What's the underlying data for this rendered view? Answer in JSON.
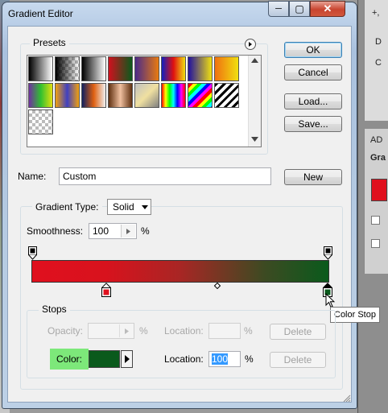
{
  "window": {
    "title": "Gradient Editor",
    "min_glyph": "─",
    "max_glyph": "▢",
    "close_glyph": "✕"
  },
  "background_app": {
    "right_texts": [
      "+,",
      "D",
      "C",
      "AD",
      "Gra"
    ]
  },
  "presets": {
    "legend": "Presets",
    "menu_icon": "circle-arrow-icon",
    "swatches": [
      "linear-gradient(90deg,#000,#fff)",
      "checker-fade-black",
      "linear-gradient(90deg,#000,#fff)",
      "linear-gradient(90deg,#d0101e,#0b5a1c)",
      "linear-gradient(90deg,#4a2a8a,#e87a10)",
      "linear-gradient(90deg,#1020c0,#e01010,#f0e010)",
      "linear-gradient(90deg,#2010a0,#f0e010)",
      "linear-gradient(90deg,#f07010,#f0e010)",
      "linear-gradient(90deg,#7030a0,#30c030,#e0e010)",
      "linear-gradient(90deg,#f0a010,#4040c0,#f0a010)",
      "linear-gradient(90deg,#102060,#e06010,#f0f0f0)",
      "linear-gradient(90deg,#603010,#f0c0a0,#603010)",
      "linear-gradient(135deg,#c0c0c0,#f0e0a0,#808080)",
      "linear-gradient(90deg,#f00,#ff0,#0f0,#0ff,#00f,#f0f,#f00)",
      "repeating-linear-gradient(135deg,#f00 0 4px,#ff0 4px 8px,#0f0 8px 12px,#0ff 12px 16px,#00f 16px 20px,#f0f 20px 24px)",
      "repeating-linear-gradient(135deg,#000 0 3px,#fff 3px 7px)",
      "checker"
    ]
  },
  "buttons": {
    "ok": "OK",
    "cancel": "Cancel",
    "load": "Load...",
    "save": "Save...",
    "new": "New"
  },
  "name_field": {
    "label": "Name:",
    "value": "Custom"
  },
  "gradient_type": {
    "legend_label": "Gradient Type:",
    "selected": "Solid"
  },
  "smoothness": {
    "label": "Smoothness:",
    "value": "100",
    "unit": "%"
  },
  "gradient": {
    "start_color": "#e0101e",
    "end_color": "#0a5a1c"
  },
  "stops": {
    "legend": "Stops",
    "opacity_label": "Opacity:",
    "opacity_unit": "%",
    "opacity_location_label": "Location:",
    "opacity_location_unit": "%",
    "opacity_delete": "Delete",
    "color_label": "Color:",
    "color_value": "#0a5a1c",
    "color_location_label": "Location:",
    "color_location_value": "100",
    "color_location_unit": "%",
    "color_delete": "Delete"
  },
  "tooltip": {
    "text": "Color Stop"
  }
}
